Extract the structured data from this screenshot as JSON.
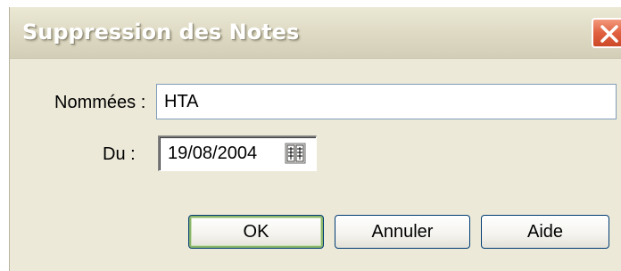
{
  "window": {
    "title": "Suppression des Notes"
  },
  "form": {
    "named_label": "Nommées :",
    "named_value": "HTA",
    "date_label": "Du :",
    "date_value": "19/08/2004"
  },
  "buttons": {
    "ok": "OK",
    "cancel": "Annuler",
    "help": "Aide"
  },
  "icons": {
    "close": "close-icon",
    "calendar": "calendar-icon"
  },
  "colors": {
    "dialog_bg": "#ece9d8",
    "close_red": "#e06040",
    "default_focus": "#8ab56a"
  }
}
